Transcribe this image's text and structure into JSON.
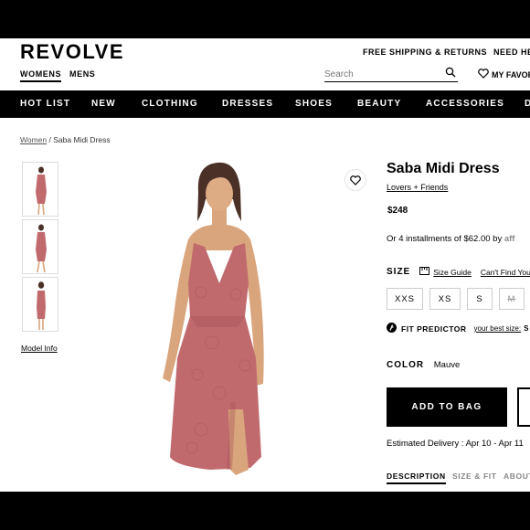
{
  "header": {
    "logo": "REVOLVE",
    "gender_tabs": [
      "WOMENS",
      "MENS"
    ],
    "shipping": "FREE SHIPPING & RETURNS",
    "help": "NEED HE",
    "search_placeholder": "Search",
    "favorites": "MY FAVOR"
  },
  "nav": {
    "items": [
      "HOT LIST",
      "NEW",
      "CLOTHING",
      "DRESSES",
      "SHOES",
      "BEAUTY",
      "ACCESSORIES",
      "D"
    ]
  },
  "breadcrumb": {
    "parent": "Women",
    "separator": "/",
    "current": "Saba Midi Dress"
  },
  "gallery": {
    "model_info": "Model Info"
  },
  "product": {
    "name": "Saba Midi Dress",
    "brand": "Lovers + Friends",
    "price": "$248",
    "installments": "Or 4 installments of $62.00 by",
    "installments_provider": "aff",
    "size_label": "SIZE",
    "size_guide": "Size Guide",
    "cant_find": "Can't Find Your",
    "sizes": [
      "XXS",
      "XS",
      "S",
      "M"
    ],
    "fit_predictor": "FIT PREDICTOR",
    "best_size_label": "your best size:",
    "best_size": "S",
    "color_label": "COLOR",
    "color_value": "Mauve",
    "add_to_bag": "ADD TO BAG",
    "delivery": "Estimated Delivery : Apr 10 - Apr 11",
    "tabs": [
      "DESCRIPTION",
      "SIZE & FIT",
      "ABOUT"
    ]
  },
  "colors": {
    "dress": "#c06a6e",
    "dress_shadow": "#a9565b",
    "skin": "#d9a57c",
    "hair": "#4a3026",
    "nav_bg": "#000000"
  }
}
